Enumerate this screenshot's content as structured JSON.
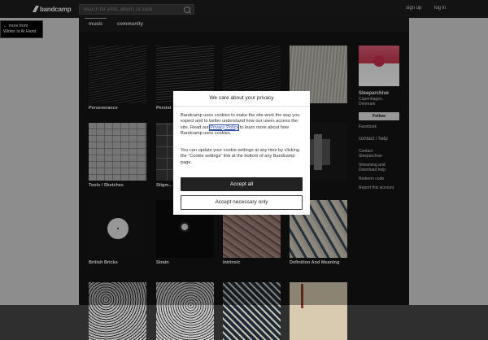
{
  "header": {
    "logo_text": "bandcamp",
    "search_placeholder": "Search for artist, album, or track",
    "signup": "sign up",
    "login": "log in"
  },
  "back": {
    "line1": "← more from",
    "line2": "Winter Is At Hand"
  },
  "tabs": [
    {
      "label": "music"
    },
    {
      "label": "community"
    }
  ],
  "albums": [
    {
      "title": "Perseverance"
    },
    {
      "title": "Persist"
    },
    {
      "title": ""
    },
    {
      "title": "...sation"
    },
    {
      "title": "Tools / Sketches"
    },
    {
      "title": "Stigm..."
    },
    {
      "title": ""
    },
    {
      "title": ""
    },
    {
      "title": "British Bricks"
    },
    {
      "title": "Strain"
    },
    {
      "title": "Intrinsic"
    },
    {
      "title": "Definition And Meaning"
    },
    {
      "title": ""
    },
    {
      "title": ""
    },
    {
      "title": ""
    },
    {
      "title": ""
    }
  ],
  "sidebar": {
    "name": "Sleeparchive",
    "location": "Copenhagen, Denmark",
    "follow": "Follow",
    "facebook": "Facebook",
    "contact_header": "contact / help",
    "contact": "Contact Sleeparchive",
    "streaming": "Streaming and Download help",
    "redeem": "Redeem code",
    "report": "Report this account"
  },
  "modal": {
    "title": "We care about your privacy",
    "p1_before": "Bandcamp uses cookies to make the site work the way you expect and to better understand how our users access the site. Read our ",
    "p1_link": "Privacy Policy",
    "p1_after": " to learn more about how Bandcamp uses cookies.",
    "p2": "You can update your cookie settings at any time by clicking the “Cookie settings” link at the bottom of any Bandcamp page.",
    "accept_all": "Accept all",
    "accept_necessary": "Accept necessary only"
  }
}
